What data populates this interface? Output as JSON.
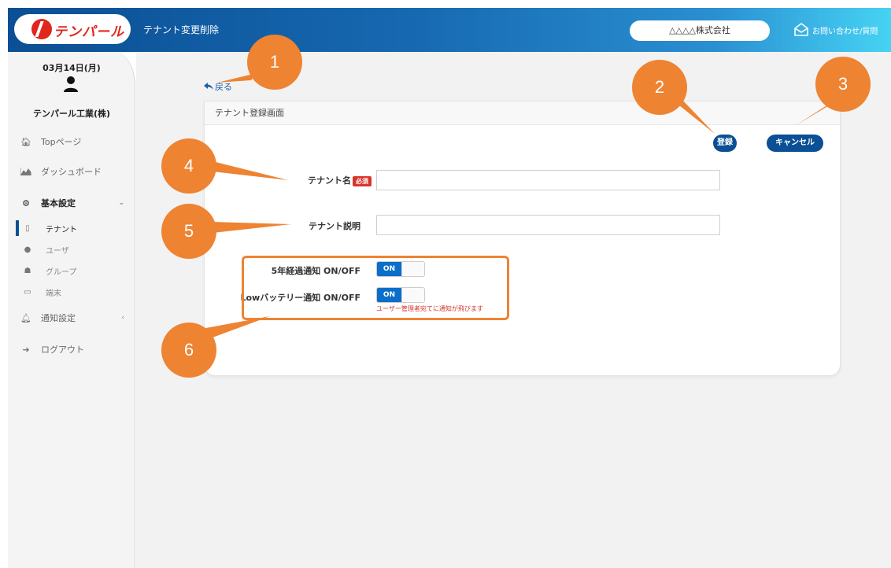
{
  "header": {
    "logo_text": "テンパール",
    "page_title": "テナント変更削除",
    "company": "△△△△株式会社",
    "contact_label": "お問い合わせ/質問"
  },
  "sidebar": {
    "date": "03月14日(月)",
    "user_name": "テンパール工業(株)",
    "items": [
      {
        "label": "Topページ",
        "icon": "home-icon"
      },
      {
        "label": "ダッシュボード",
        "icon": "chart-area-icon"
      },
      {
        "label": "基本設定",
        "icon": "gear-icon"
      },
      {
        "label": "テナント",
        "icon": "building-icon"
      },
      {
        "label": "ユーザ",
        "icon": "user-icon"
      },
      {
        "label": "グループ",
        "icon": "users-icon"
      },
      {
        "label": "端末",
        "icon": "laptop-icon"
      },
      {
        "label": "通知設定",
        "icon": "bell-icon"
      },
      {
        "label": "ログアウト",
        "icon": "logout-icon"
      }
    ]
  },
  "main": {
    "back_label": "戻る",
    "card_title": "テナント登録画面",
    "register_label": "登録",
    "cancel_label": "キャンセル",
    "tenant_name_label": "テナント名",
    "required_badge": "必須",
    "tenant_name_value": "",
    "tenant_desc_label": "テナント説明",
    "tenant_desc_value": "",
    "toggle1_label": "5年経過通知 ON/OFF",
    "toggle1_state": "ON",
    "toggle2_label": "Lowバッテリー通知 ON/OFF",
    "toggle2_state": "ON",
    "toggle2_note": "ユーザー管理者宛てに通知が飛びます"
  },
  "annotations": [
    "1",
    "2",
    "3",
    "4",
    "5",
    "6"
  ],
  "colors": {
    "header_start": "#0b4f94",
    "header_end": "#46d3f3",
    "primary": "#0b4f94",
    "accent_orange": "#ee8332",
    "required_red": "#d9342b"
  }
}
